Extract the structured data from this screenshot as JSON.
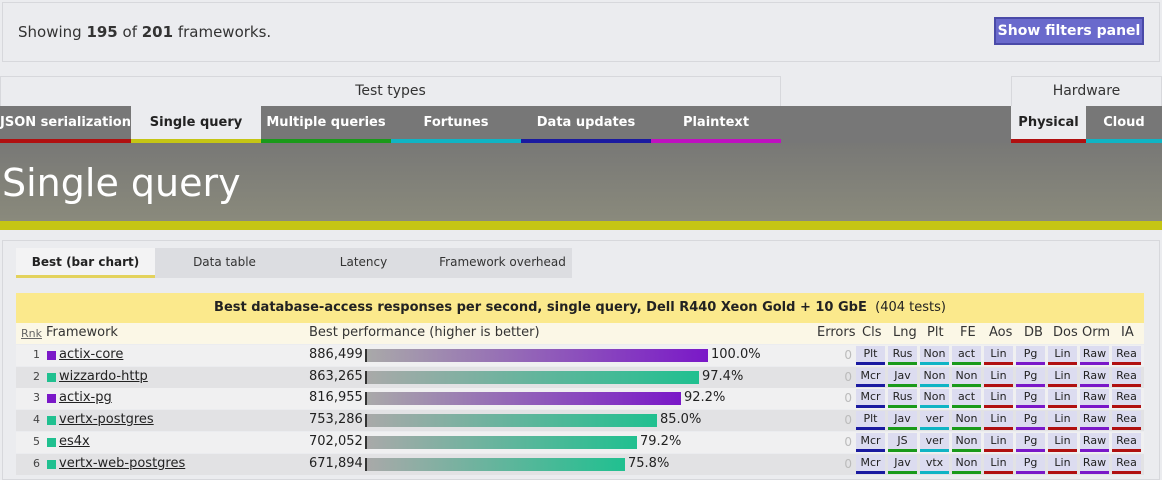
{
  "summary": {
    "prefix": "Showing ",
    "shown": "195",
    "of": " of ",
    "total": "201",
    "suffix": " frameworks."
  },
  "filters_button": "Show filters panel",
  "test_types_label": "Test types",
  "hardware_label": "Hardware",
  "test_tabs": [
    {
      "label": "JSON serialization",
      "color": "#b01010",
      "active": false
    },
    {
      "label": "Single query",
      "color": "#c5c514",
      "active": true
    },
    {
      "label": "Multiple queries",
      "color": "#1a9a1a",
      "active": false
    },
    {
      "label": "Fortunes",
      "color": "#10b4c4",
      "active": false
    },
    {
      "label": "Data updates",
      "color": "#1a1aa0",
      "active": false
    },
    {
      "label": "Plaintext",
      "color": "#c010c0",
      "active": false
    }
  ],
  "hardware_tabs": [
    {
      "label": "Physical",
      "color": "#b01010",
      "active": true
    },
    {
      "label": "Cloud",
      "color": "#10b4c4",
      "active": false
    }
  ],
  "banner_title": "Single query",
  "view_tabs": [
    {
      "label": "Best (bar chart)",
      "active": true
    },
    {
      "label": "Data table",
      "active": false
    },
    {
      "label": "Latency",
      "active": false
    },
    {
      "label": "Framework overhead",
      "active": false
    }
  ],
  "chart_title": "Best database-access responses per second, single query, Dell R440 Xeon Gold + 10 GbE",
  "chart_tests": "(404 tests)",
  "columns": {
    "rnk": "Rnk",
    "framework": "Framework",
    "best": "Best performance (higher is better)",
    "errors": "Errors",
    "attrs": [
      "Cls",
      "Lng",
      "Plt",
      "FE",
      "Aos",
      "DB",
      "Dos",
      "Orm",
      "IA"
    ]
  },
  "colors": {
    "purple": "#7a18c8",
    "green": "#20c090",
    "attr_bg": "#dcdcf0"
  },
  "rows": [
    {
      "rank": "1",
      "name": "actix-core",
      "value": "886,499",
      "pct": "100.0%",
      "fraction": 1.0,
      "swatch": "#7a18c8",
      "bar_end": "#7a18c8",
      "errors": "0",
      "attrs": [
        "Plt",
        "Rus",
        "Non",
        "act",
        "Lin",
        "Pg",
        "Lin",
        "Raw",
        "Rea"
      ]
    },
    {
      "rank": "2",
      "name": "wizzardo-http",
      "value": "863,265",
      "pct": "97.4%",
      "fraction": 0.974,
      "swatch": "#20c090",
      "bar_end": "#20c090",
      "errors": "0",
      "attrs": [
        "Mcr",
        "Jav",
        "Non",
        "Non",
        "Lin",
        "Pg",
        "Lin",
        "Raw",
        "Rea"
      ]
    },
    {
      "rank": "3",
      "name": "actix-pg",
      "value": "816,955",
      "pct": "92.2%",
      "fraction": 0.922,
      "swatch": "#7a18c8",
      "bar_end": "#7a18c8",
      "errors": "0",
      "attrs": [
        "Mcr",
        "Rus",
        "Non",
        "act",
        "Lin",
        "Pg",
        "Lin",
        "Raw",
        "Rea"
      ]
    },
    {
      "rank": "4",
      "name": "vertx-postgres",
      "value": "753,286",
      "pct": "85.0%",
      "fraction": 0.85,
      "swatch": "#20c090",
      "bar_end": "#20c090",
      "errors": "0",
      "attrs": [
        "Plt",
        "Jav",
        "ver",
        "Non",
        "Lin",
        "Pg",
        "Lin",
        "Raw",
        "Rea"
      ]
    },
    {
      "rank": "5",
      "name": "es4x",
      "value": "702,052",
      "pct": "79.2%",
      "fraction": 0.792,
      "swatch": "#20c090",
      "bar_end": "#20c090",
      "errors": "0",
      "attrs": [
        "Mcr",
        "JS",
        "ver",
        "Non",
        "Lin",
        "Pg",
        "Lin",
        "Raw",
        "Rea"
      ]
    },
    {
      "rank": "6",
      "name": "vertx-web-postgres",
      "value": "671,894",
      "pct": "75.8%",
      "fraction": 0.758,
      "swatch": "#20c090",
      "bar_end": "#20c090",
      "errors": "0",
      "attrs": [
        "Mcr",
        "Jav",
        "vtx",
        "Non",
        "Lin",
        "Pg",
        "Lin",
        "Raw",
        "Rea"
      ]
    }
  ]
}
